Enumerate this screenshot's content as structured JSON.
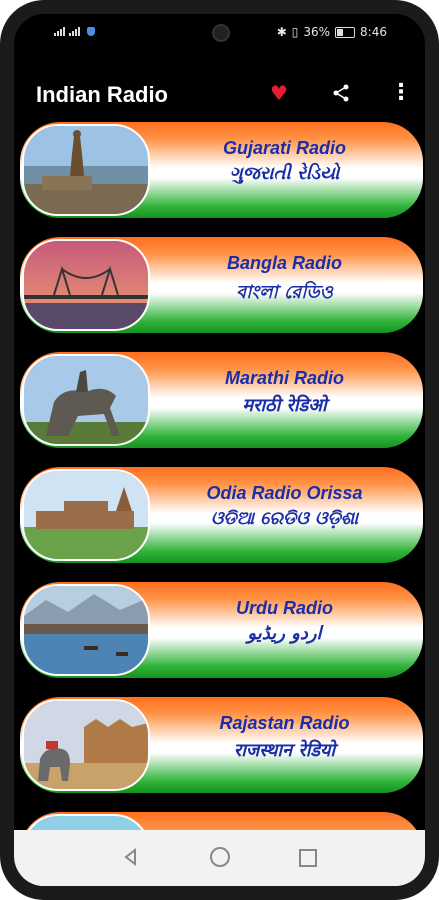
{
  "status": {
    "battery": "36%",
    "time": "8:46"
  },
  "app": {
    "title": "Indian Radio"
  },
  "icons": {
    "favorite": "heart-icon",
    "share": "share-icon",
    "more": "more-vert-icon"
  },
  "colors": {
    "saffron": "#ff6f1e",
    "white": "#ffffff",
    "green": "#2fb33a",
    "text": "#1a2ea8",
    "favorite": "#e11d2e"
  },
  "stations": [
    {
      "title": "Gujarati Radio",
      "subtitle": "ગુજરાતી રેડિયો",
      "image": "statue-landscape"
    },
    {
      "title": "Bangla Radio",
      "subtitle": "বাংলা রেডিও",
      "image": "bridge-sunset"
    },
    {
      "title": "Marathi Radio",
      "subtitle": "मराठी रेडिओ",
      "image": "horse-statue"
    },
    {
      "title": "Odia Radio Orissa",
      "subtitle": "ଓଡିଆ ରେଡିଓ ଓଡ଼ିଶା",
      "image": "temple-ruins"
    },
    {
      "title": "Urdu Radio",
      "subtitle": "اردو ریڈیو",
      "image": "lake-mountains"
    },
    {
      "title": "Rajastan Radio",
      "subtitle": "राजस्थान रेडियो",
      "image": "fort-elephant"
    }
  ]
}
